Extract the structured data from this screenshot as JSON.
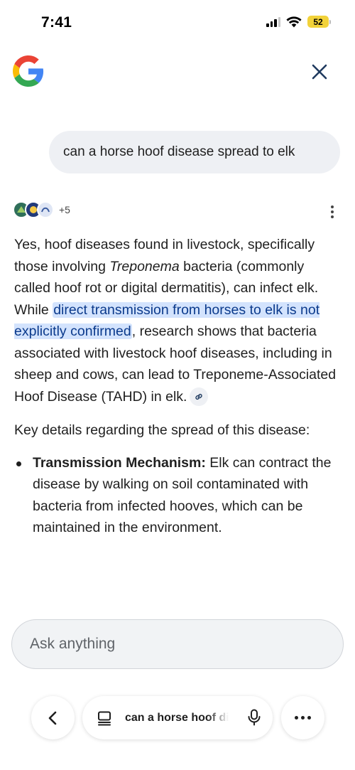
{
  "status_bar": {
    "time": "7:41",
    "battery": "52",
    "battery_color": "#f2d23a"
  },
  "header": {
    "logo_icon": "google-g-icon",
    "close_icon": "close-icon"
  },
  "query": {
    "text": "can a horse hoof disease spread to elk"
  },
  "sources": {
    "more_count": "+5",
    "icons": [
      "source-logo-icon",
      "source-logo-icon",
      "source-logo-icon"
    ]
  },
  "answer": {
    "p1": {
      "part1": "Yes, hoof diseases found in livestock, specifically those involving ",
      "italic": "Treponema",
      "part2": " bacteria (commonly called hoof rot or digital dermatitis), can infect elk. While ",
      "highlight": "direct transmission from horses to elk is not explicitly confirmed",
      "part3": ", research shows that bacteria associated with livestock hoof diseases, including in sheep and cows, can lead to Treponeme-Associated Hoof Disease (TAHD) in elk."
    },
    "p2": "Key details regarding the spread of this disease:",
    "bullets": [
      {
        "title": "Transmission Mechanism:",
        "text": " Elk can contract the disease by walking on soil contaminated with bacteria from infected hooves, which can be maintained in the environment."
      }
    ],
    "highlight_color": "#d3e3fd"
  },
  "ask": {
    "placeholder": "Ask anything"
  },
  "bottom_nav": {
    "pill_query": "can a horse hoof disease spread to elk"
  }
}
